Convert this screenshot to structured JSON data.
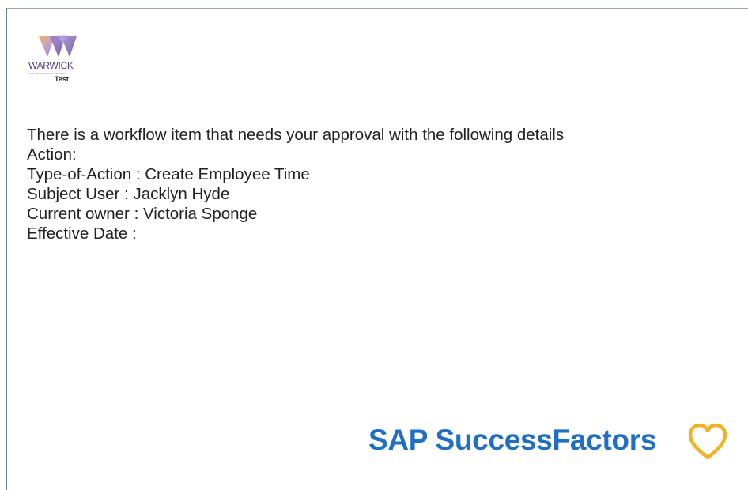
{
  "logo": {
    "wordmark": "WARWICK",
    "tagline": "THE UNIVERSITY OF WARWICK",
    "subtitle": "Test",
    "colors": [
      "#d9a23a",
      "#8a6bc2",
      "#5a3d8a"
    ]
  },
  "message": {
    "intro": "There is a workflow item that needs your approval with the following details",
    "action": "Action:",
    "type_of_action": "Type-of-Action : Create Employee Time",
    "subject_user": "Subject User : Jacklyn Hyde",
    "current_owner": "Current owner : Victoria Sponge",
    "effective_date": "Effective Date :"
  },
  "brand": {
    "name": "SAP SuccessFactors",
    "icon": "heart-icon",
    "text_color": "#1f6fc5",
    "icon_color": "#f0b323"
  }
}
